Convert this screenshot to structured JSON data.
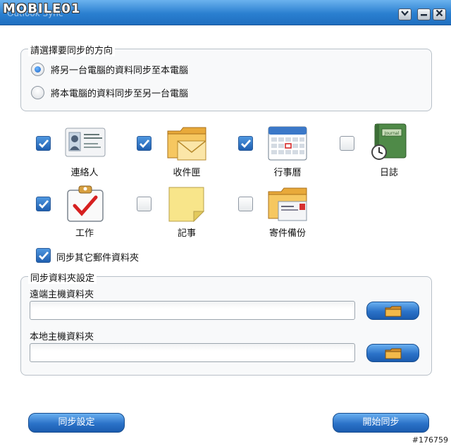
{
  "window": {
    "logo_text": "MOBILE01",
    "title": "Outlook Sync",
    "buttons": {
      "menu_icon": "chevron-down-icon",
      "minimize_icon": "minimize-icon",
      "close_icon": "close-icon"
    }
  },
  "direction": {
    "group_title": "請選擇要同步的方向",
    "options": [
      {
        "label": "將另一台電腦的資料同步至本電腦",
        "selected": true
      },
      {
        "label": "將本電腦的資料同步至另一台電腦",
        "selected": false
      }
    ]
  },
  "items": [
    {
      "label": "連絡人",
      "checked": true,
      "icon": "contact-card-icon"
    },
    {
      "label": "收件匣",
      "checked": true,
      "icon": "inbox-folder-icon"
    },
    {
      "label": "行事曆",
      "checked": true,
      "icon": "calendar-icon"
    },
    {
      "label": "日誌",
      "checked": false,
      "icon": "journal-icon",
      "icon_text": "Journal"
    },
    {
      "label": "工作",
      "checked": true,
      "icon": "task-clipboard-icon"
    },
    {
      "label": "記事",
      "checked": false,
      "icon": "sticky-note-icon"
    },
    {
      "label": "寄件備份",
      "checked": false,
      "icon": "sent-items-folder-icon"
    }
  ],
  "sync_other_folders": {
    "label": "同步其它郵件資料夾",
    "checked": true
  },
  "folder_settings": {
    "group_title": "同步資料夾設定",
    "remote_label": "遠端主機資料夾",
    "remote_value": "",
    "local_label": "本地主機資料夾",
    "local_value": "",
    "browse_icon": "folder-icon"
  },
  "actions": {
    "settings_label": "同步設定",
    "start_label": "開始同步"
  },
  "watermark": "#176759",
  "colors": {
    "titlebar": "#2a7fd0",
    "button_blue": "#2b72c8",
    "check_blue": "#1f5fb0"
  }
}
